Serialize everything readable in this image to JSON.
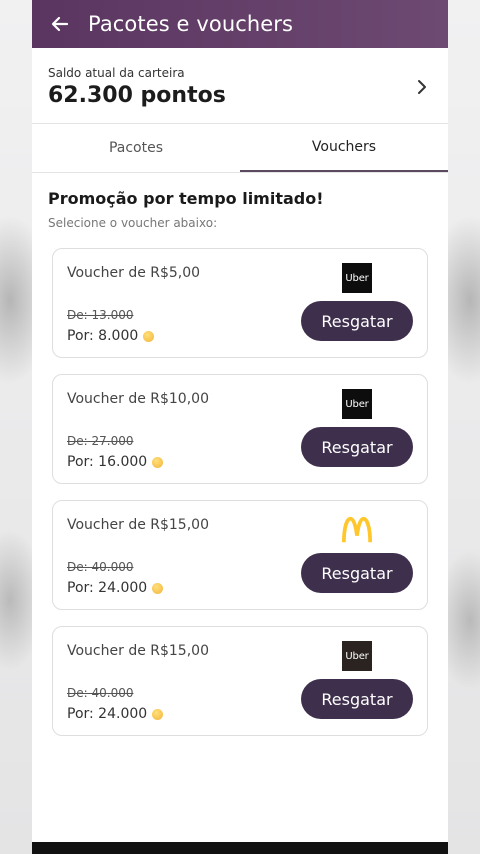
{
  "appbar": {
    "title": "Pacotes e vouchers"
  },
  "wallet": {
    "label": "Saldo atual da carteira",
    "points": "62.300 pontos"
  },
  "tabs": [
    {
      "label": "Pacotes",
      "active": false
    },
    {
      "label": "Vouchers",
      "active": true
    }
  ],
  "promo": {
    "title": "Promoção por tempo limitado!",
    "subtitle": "Selecione o voucher abaixo:"
  },
  "vouchers": [
    {
      "title": "Voucher de R$5,00",
      "old_price": "De: 13.000",
      "new_price": "Por: 8.000",
      "brand": "uber",
      "brand_text": "Uber",
      "button": "Resgatar"
    },
    {
      "title": "Voucher de R$10,00",
      "old_price": "De: 27.000",
      "new_price": "Por: 16.000",
      "brand": "uber",
      "brand_text": "Uber",
      "button": "Resgatar"
    },
    {
      "title": "Voucher de R$15,00",
      "old_price": "De: 40.000",
      "new_price": "Por: 24.000",
      "brand": "mcdonalds",
      "brand_text": "",
      "button": "Resgatar"
    },
    {
      "title": "Voucher de R$15,00",
      "old_price": "De: 40.000",
      "new_price": "Por: 24.000",
      "brand": "uber",
      "brand_text": "Uber",
      "button": "Resgatar"
    }
  ],
  "colors": {
    "appbar": "#5a3560",
    "button": "#3e2f4d",
    "coin": "#f2b33a",
    "mcdonalds": "#ffc72c"
  },
  "icons": {
    "back": "arrow-left-icon",
    "chevron": "chevron-right-icon",
    "coin": "coin-icon"
  }
}
